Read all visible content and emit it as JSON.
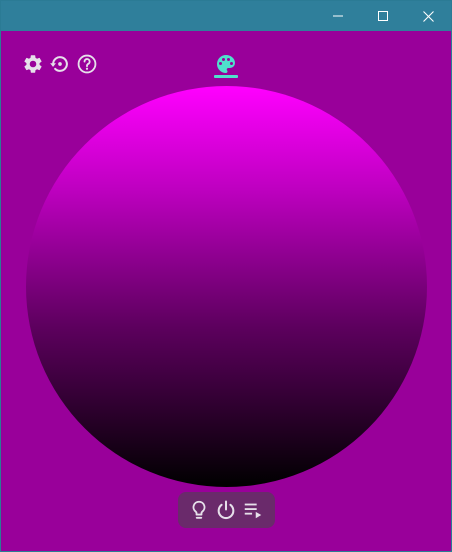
{
  "window": {
    "titlebar_color": "#2f7f9b",
    "background_color": "#99009a",
    "controls": [
      {
        "name": "minimize",
        "icon": "minimize-icon"
      },
      {
        "name": "maximize",
        "icon": "maximize-icon"
      },
      {
        "name": "close",
        "icon": "close-icon"
      }
    ]
  },
  "toolbar": {
    "icons": [
      {
        "name": "settings",
        "icon": "gear-icon",
        "color": "#e6e0ea"
      },
      {
        "name": "reset",
        "icon": "restore-history-icon",
        "color": "#e6e0ea"
      },
      {
        "name": "help",
        "icon": "help-circle-icon",
        "color": "#e6e0ea"
      }
    ]
  },
  "tabs": [
    {
      "name": "palette",
      "icon": "palette-icon",
      "active": true,
      "accent": "#4fe0cc"
    }
  ],
  "color_sphere": {
    "gradient_top": "#ff00ff",
    "gradient_bottom": "#000000"
  },
  "bottom_bar": {
    "background": "#6a2a6b",
    "buttons": [
      {
        "name": "light",
        "icon": "lightbulb-icon"
      },
      {
        "name": "power",
        "icon": "power-icon"
      },
      {
        "name": "playlist",
        "icon": "playlist-play-icon"
      }
    ]
  }
}
